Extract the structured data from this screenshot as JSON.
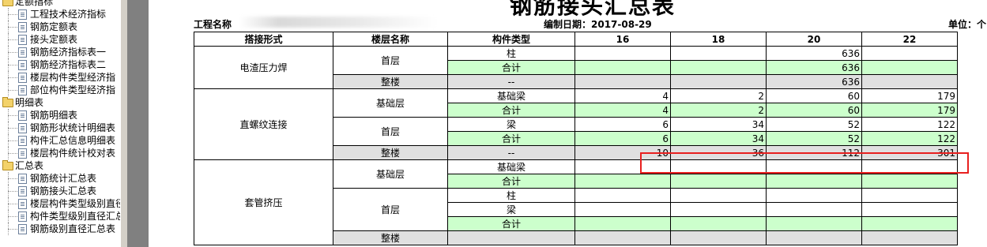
{
  "tree": {
    "items": [
      {
        "level": 0,
        "type": "folder",
        "label": "定额指标"
      },
      {
        "level": 1,
        "type": "doc",
        "label": "工程技术经济指标"
      },
      {
        "level": 1,
        "type": "doc",
        "label": "钢筋定额表"
      },
      {
        "level": 1,
        "type": "doc",
        "label": "接头定额表"
      },
      {
        "level": 1,
        "type": "doc",
        "label": "钢筋经济指标表一"
      },
      {
        "level": 1,
        "type": "doc",
        "label": "钢筋经济指标表二"
      },
      {
        "level": 1,
        "type": "doc",
        "label": "楼层构件类型经济指"
      },
      {
        "level": 1,
        "type": "doc",
        "label": "部位构件类型经济指"
      },
      {
        "level": 0,
        "type": "folder",
        "label": "明细表"
      },
      {
        "level": 1,
        "type": "doc",
        "label": "钢筋明细表"
      },
      {
        "level": 1,
        "type": "doc",
        "label": "钢筋形状统计明细表"
      },
      {
        "level": 1,
        "type": "doc",
        "label": "构件汇总信息明细表"
      },
      {
        "level": 1,
        "type": "doc",
        "label": "楼层构件统计校对表"
      },
      {
        "level": 0,
        "type": "folder",
        "label": "汇总表"
      },
      {
        "level": 1,
        "type": "doc",
        "label": "钢筋统计汇总表"
      },
      {
        "level": 1,
        "type": "doc",
        "label": "钢筋接头汇总表"
      },
      {
        "level": 1,
        "type": "doc",
        "label": "楼层构件类型级别直径"
      },
      {
        "level": 1,
        "type": "doc",
        "label": "构件类型级别直径汇总"
      },
      {
        "level": 1,
        "type": "doc",
        "label": "钢筋级别直径汇总表"
      }
    ]
  },
  "report": {
    "title": "钢筋接头汇总表",
    "project_label": "工程名称",
    "date_label": "编制日期：2017-08-29",
    "unit_label": "单位：个"
  },
  "table": {
    "headers": [
      "搭接形式",
      "楼层名称",
      "构件类型",
      "16",
      "18",
      "20",
      "22"
    ],
    "rows": [
      {
        "kind": "normal",
        "joint": "电渣压力焊",
        "floor": "首层",
        "comp": "柱",
        "v": [
          "",
          "",
          "636",
          ""
        ]
      },
      {
        "kind": "sum",
        "comp": "合计",
        "v": [
          "",
          "",
          "636",
          ""
        ]
      },
      {
        "kind": "all",
        "floor": "整楼",
        "comp": "--",
        "v": [
          "",
          "",
          "636",
          ""
        ]
      },
      {
        "kind": "normal",
        "joint": "直螺纹连接",
        "floor": "基础层",
        "comp": "基础梁",
        "v": [
          "4",
          "2",
          "60",
          "179"
        ]
      },
      {
        "kind": "sum",
        "comp": "合计",
        "v": [
          "4",
          "2",
          "60",
          "179"
        ]
      },
      {
        "kind": "normal",
        "floor": "首层",
        "comp": "梁",
        "v": [
          "6",
          "34",
          "52",
          "122"
        ]
      },
      {
        "kind": "sum",
        "comp": "合计",
        "v": [
          "6",
          "34",
          "52",
          "122"
        ]
      },
      {
        "kind": "all",
        "floor": "整楼",
        "comp": "--",
        "v": [
          "10",
          "36",
          "112",
          "301"
        ]
      },
      {
        "kind": "normal",
        "joint": "套管挤压",
        "floor": "基础层",
        "comp": "基础梁",
        "v": [
          "",
          "",
          "",
          ""
        ]
      },
      {
        "kind": "sum",
        "comp": "合计",
        "v": [
          "",
          "",
          "",
          ""
        ]
      },
      {
        "kind": "normal",
        "floor": "首层",
        "comp": "柱",
        "v": [
          "",
          "",
          "",
          ""
        ]
      },
      {
        "kind": "normal",
        "comp": "梁",
        "v": [
          "",
          "",
          "",
          ""
        ]
      },
      {
        "kind": "sum",
        "comp": "合计",
        "v": [
          "",
          "",
          "",
          ""
        ]
      },
      {
        "kind": "all",
        "floor": "整楼",
        "comp": "",
        "v": [
          "",
          "",
          "",
          ""
        ]
      }
    ]
  },
  "colors": {
    "sum_row": "#ccffcc",
    "all_row": "#e0e0e0",
    "highlight": "#e8201f"
  }
}
